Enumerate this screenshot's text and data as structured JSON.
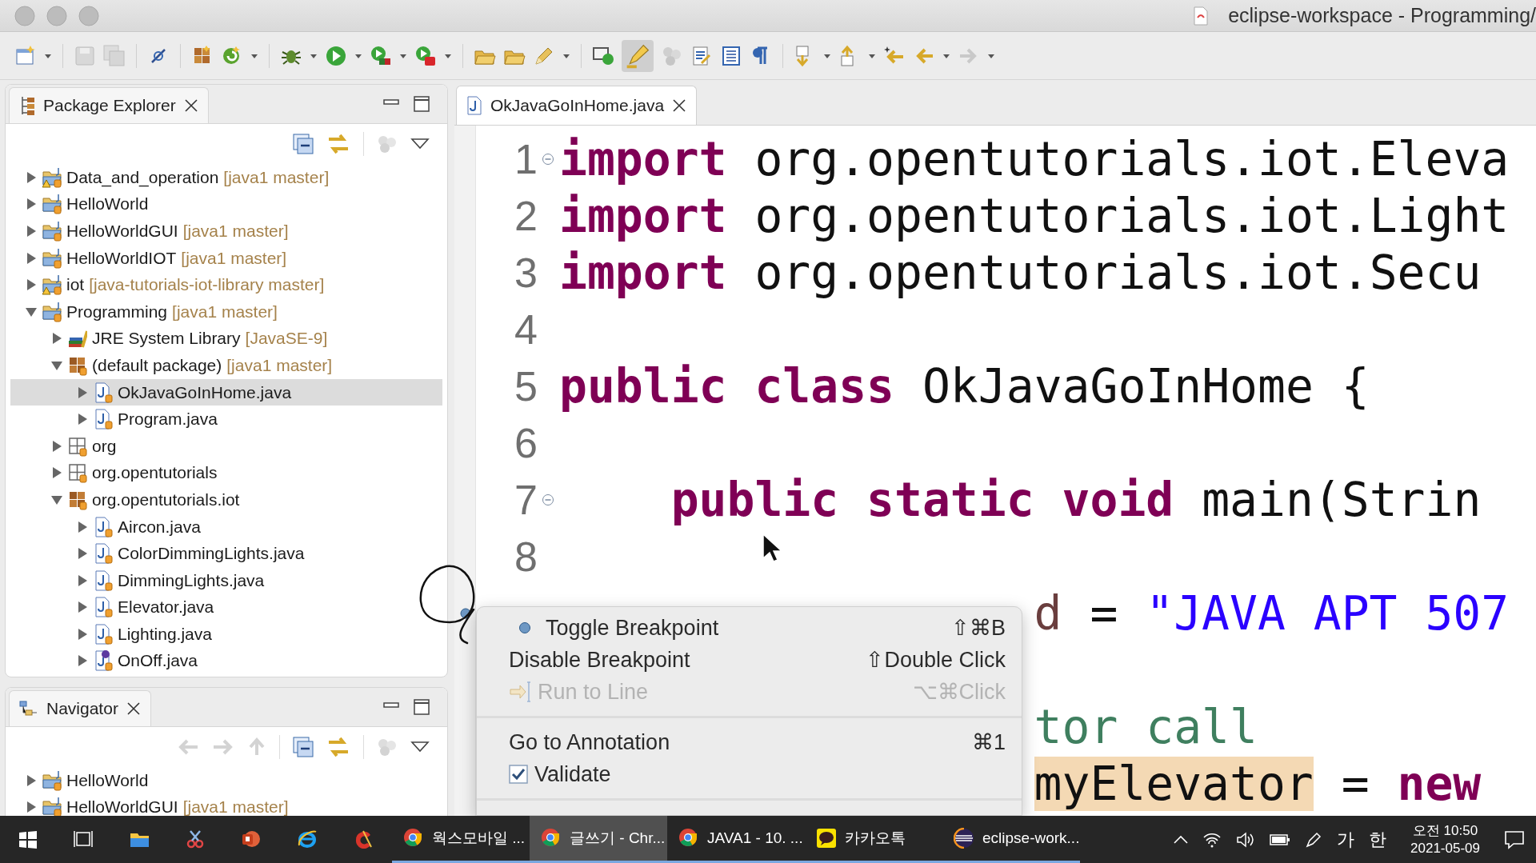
{
  "window": {
    "title": "eclipse-workspace - Programming/"
  },
  "package_explorer": {
    "title": "Package Explorer",
    "items": [
      {
        "label": "Data_and_operation",
        "decoration": "[java1 master]",
        "kind": "project-warning",
        "expanded": false,
        "selected": false
      },
      {
        "label": "HelloWorld",
        "kind": "project",
        "expanded": false,
        "selected": false
      },
      {
        "label": "HelloWorldGUI",
        "decoration": "[java1 master]",
        "kind": "project",
        "expanded": false,
        "selected": false
      },
      {
        "label": "HelloWorldIOT",
        "decoration": "[java1 master]",
        "kind": "project",
        "expanded": false,
        "selected": false
      },
      {
        "label": "iot",
        "decoration": "[java-tutorials-iot-library master]",
        "kind": "project-warning",
        "expanded": false,
        "selected": false
      },
      {
        "label": "Programming",
        "decoration": "[java1 master]",
        "kind": "project",
        "expanded": true,
        "selected": false,
        "children": [
          {
            "label": "JRE System Library",
            "decoration": "[JavaSE-9]",
            "kind": "library",
            "expanded": false,
            "selected": false
          },
          {
            "label": "(default package)",
            "decoration": "[java1 master]",
            "kind": "package",
            "expanded": true,
            "selected": false,
            "children": [
              {
                "label": "OkJavaGoInHome.java",
                "kind": "java",
                "expanded": false,
                "selected": true
              },
              {
                "label": "Program.java",
                "kind": "java",
                "expanded": false,
                "selected": false
              }
            ]
          },
          {
            "label": "org",
            "kind": "package-empty",
            "expanded": false,
            "selected": false
          },
          {
            "label": "org.opentutorials",
            "kind": "package-empty",
            "expanded": false,
            "selected": false
          },
          {
            "label": "org.opentutorials.iot",
            "kind": "package",
            "expanded": true,
            "selected": false,
            "children": [
              {
                "label": "Aircon.java",
                "kind": "java",
                "expanded": false,
                "selected": false
              },
              {
                "label": "ColorDimmingLights.java",
                "kind": "java",
                "expanded": false,
                "selected": false
              },
              {
                "label": "DimmingLights.java",
                "kind": "java",
                "expanded": false,
                "selected": false
              },
              {
                "label": "Elevator.java",
                "kind": "java",
                "expanded": false,
                "selected": false
              },
              {
                "label": "Lighting.java",
                "kind": "java",
                "expanded": false,
                "selected": false
              },
              {
                "label": "OnOff.java",
                "kind": "interface",
                "expanded": false,
                "selected": false
              }
            ]
          }
        ]
      }
    ]
  },
  "navigator": {
    "title": "Navigator",
    "items": [
      {
        "label": "HelloWorld",
        "kind": "project",
        "expanded": false,
        "selected": false
      },
      {
        "label": "HelloWorldGUI",
        "decoration": "[java1 master]",
        "kind": "project",
        "expanded": false,
        "selected": false
      }
    ]
  },
  "editor": {
    "tab": {
      "label": "OkJavaGoInHome.java",
      "selected": true
    },
    "lines": [
      {
        "number": "1",
        "fold": true,
        "breakpoint": false,
        "tokens": [
          {
            "kind": "keyword",
            "text": "import"
          },
          {
            "kind": "plain",
            "text": " org.opentutorials.iot.Eleva"
          }
        ]
      },
      {
        "number": "2",
        "fold": false,
        "breakpoint": false,
        "tokens": [
          {
            "kind": "keyword",
            "text": "import"
          },
          {
            "kind": "plain",
            "text": " org.opentutorials.iot.Light"
          }
        ]
      },
      {
        "number": "3",
        "fold": false,
        "breakpoint": false,
        "tokens": [
          {
            "kind": "keyword",
            "text": "import"
          },
          {
            "kind": "plain",
            "text": " org.opentutorials.iot.Secu"
          }
        ]
      },
      {
        "number": "4",
        "fold": false,
        "breakpoint": false
      },
      {
        "number": "5",
        "fold": false,
        "breakpoint": false,
        "tokens": [
          {
            "kind": "keyword",
            "text": "public class"
          },
          {
            "kind": "plain",
            "text": " OkJavaGoInHome {"
          }
        ]
      },
      {
        "number": "6",
        "fold": false,
        "breakpoint": false
      },
      {
        "number": "7",
        "fold": true,
        "breakpoint": false,
        "tokens": [
          {
            "kind": "keyword",
            "text": "    public static void"
          },
          {
            "kind": "plain",
            "text": " main(Strin"
          }
        ]
      },
      {
        "number": "8",
        "fold": false,
        "breakpoint": false
      },
      {
        "breakpoint": true,
        "tokens": [
          {
            "kind": "variable",
            "text": "d"
          },
          {
            "kind": "plain",
            "text": " = "
          },
          {
            "kind": "string",
            "text": "\"JAVA APT 507"
          }
        ]
      },
      {
        "tokens": [
          {
            "kind": "comment",
            "text": "tor call"
          }
        ]
      },
      {
        "tokens": [
          {
            "kind": "highlight",
            "text": "myElevator"
          },
          {
            "kind": "plain",
            "text": " = "
          },
          {
            "kind": "keyword",
            "text": "new"
          }
        ]
      }
    ]
  },
  "context_menu": {
    "items": [
      {
        "kind": "breakpoint",
        "label": "Toggle Breakpoint",
        "shortcut": "⇧⌘B",
        "disabled": false
      },
      {
        "kind": "plain",
        "label": "Disable Breakpoint",
        "shortcut": "⇧Double Click",
        "disabled": false
      },
      {
        "kind": "run-to-line",
        "label": "Run to Line",
        "shortcut": "⌥⌘Click",
        "disabled": true
      },
      {
        "kind": "separator"
      },
      {
        "kind": "plain",
        "label": "Go to Annotation",
        "shortcut": "⌘1",
        "disabled": false
      },
      {
        "kind": "check",
        "label": "Validate",
        "checked": true,
        "disabled": false
      },
      {
        "kind": "separator"
      }
    ]
  },
  "taskbar": {
    "apps": [
      {
        "kind": "start",
        "selected": false
      },
      {
        "kind": "task-view",
        "selected": false
      },
      {
        "kind": "explorer",
        "selected": false
      },
      {
        "kind": "snip",
        "selected": false
      },
      {
        "kind": "powerpoint",
        "selected": false
      },
      {
        "kind": "ie",
        "selected": false
      },
      {
        "kind": "ccleaner",
        "selected": false
      },
      {
        "kind": "chrome",
        "label": "웍스모바일 ...",
        "selected": false
      },
      {
        "kind": "chrome",
        "label": "글쓰기 - Chr...",
        "selected": true
      },
      {
        "kind": "chrome",
        "label": "JAVA1 - 10. ...",
        "selected": false
      },
      {
        "kind": "kakaotalk",
        "label": "카카오톡",
        "selected": false
      },
      {
        "kind": "eclipse",
        "label": "eclipse-work...",
        "selected": false
      }
    ],
    "tray": {
      "ime_mode": "가",
      "ime": "한",
      "time": "오전 10:50",
      "date": "2021-05-09"
    }
  }
}
